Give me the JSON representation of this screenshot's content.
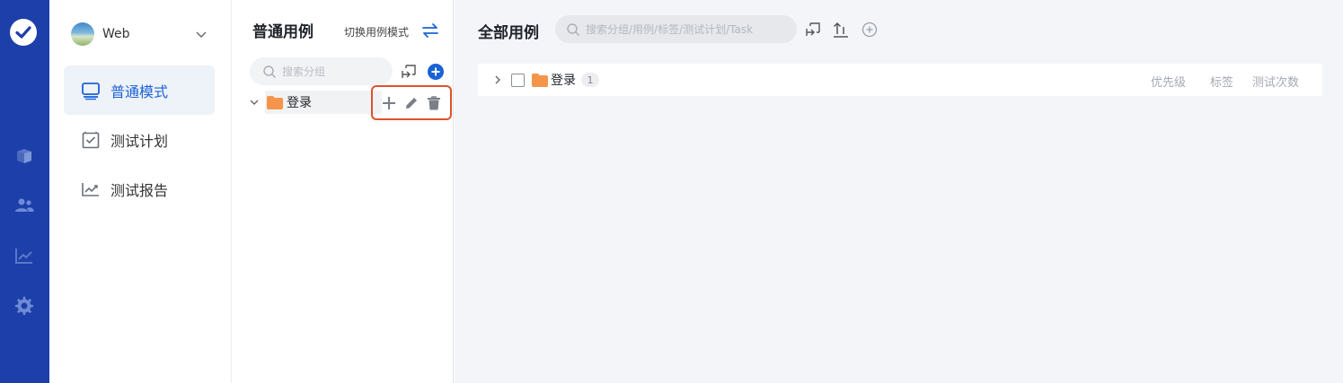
{
  "project": {
    "name": "Web"
  },
  "modes": [
    {
      "label": "普通模式",
      "icon": "monitor-icon",
      "active": true
    },
    {
      "label": "测试计划",
      "icon": "checklist-icon",
      "active": false
    },
    {
      "label": "测试报告",
      "icon": "trend-chart-icon",
      "active": false
    }
  ],
  "tree": {
    "title": "普通用例",
    "switch_label": "切换用例模式",
    "search_placeholder": "搜索分组",
    "nodes": [
      {
        "label": "登录"
      }
    ]
  },
  "main": {
    "title": "全部用例",
    "search_placeholder": "搜索分组/用例/标签/测试计划/Task",
    "rows": [
      {
        "label": "登录",
        "count": "1"
      }
    ],
    "columns": {
      "priority": "优先级",
      "tags": "标签",
      "test_count": "测试次数"
    }
  },
  "colors": {
    "rail": "#1d3faa",
    "accent": "#1a62d6",
    "folder": "#f4954b",
    "highlight_border": "#e0522b"
  }
}
